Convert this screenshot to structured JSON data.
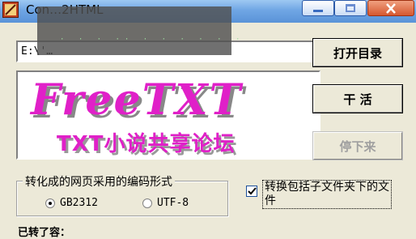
{
  "window": {
    "title": "Con…2HTML",
    "colors": {
      "face": "#ece9d8",
      "logo": "#e020c8"
    }
  },
  "path_field": {
    "value": "E:\\'…"
  },
  "banner": {
    "logo_text": "FreeTXT",
    "subtitle": "TXT小说共享论坛"
  },
  "buttons": {
    "open_dir": "打开目录",
    "run": "干 活",
    "stop": "停下来"
  },
  "encoding_group": {
    "legend": "转化成的网页采用的编码形式",
    "options": [
      {
        "label": "GB2312",
        "selected": true
      },
      {
        "label": "UTF-8",
        "selected": false
      }
    ]
  },
  "subfolder_option": {
    "label": "转换包括子文件夹下的文件",
    "checked": true
  },
  "bottom_text": "已转了容："
}
